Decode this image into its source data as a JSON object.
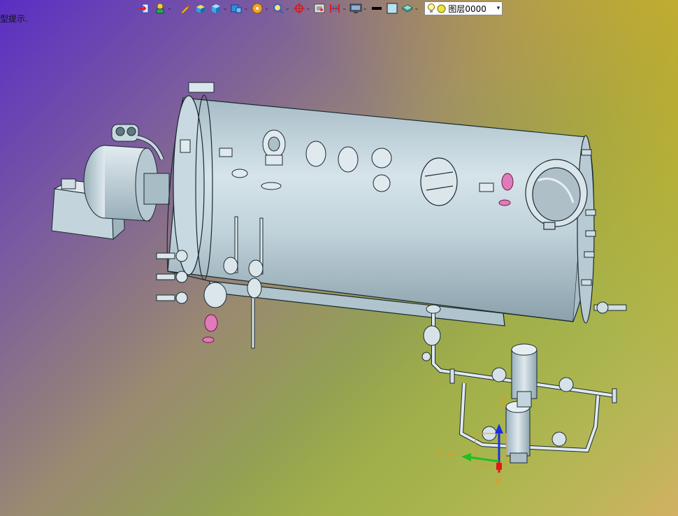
{
  "hint_text": "型提示.",
  "toolbar": {
    "items": [
      {
        "name": "exit-sketch-icon",
        "caret": false
      },
      {
        "name": "part-mode-icon",
        "caret": true
      },
      {
        "name": "pencil-icon",
        "caret": false
      },
      {
        "name": "box-solid-icon",
        "caret": false
      },
      {
        "name": "view-cube-icon",
        "caret": true
      },
      {
        "name": "view-orient-icon",
        "caret": true
      },
      {
        "name": "render-style-icon",
        "caret": true
      },
      {
        "name": "zoom-icon",
        "caret": true
      },
      {
        "name": "pan-rotate-icon",
        "caret": true
      },
      {
        "name": "display-filter-icon",
        "caret": false
      },
      {
        "name": "section-view-icon",
        "caret": true
      },
      {
        "name": "monitor-icon",
        "caret": true
      },
      {
        "name": "line-width-icon",
        "caret": false
      },
      {
        "name": "color-swatch-icon",
        "caret": false
      },
      {
        "name": "layer-tools-icon",
        "caret": true
      }
    ],
    "caret_char": "⌄"
  },
  "layer_dropdown": {
    "label": "图层0000",
    "arrow": "▾"
  },
  "triad": {
    "x_label": "X",
    "y_label": "Y",
    "z_label": "Z"
  },
  "colors": {
    "vessel": "#c8d8e2",
    "vessel_shadow": "#8fa6b2",
    "valve_pink": "#e07ab8",
    "axis_x": "#e01818",
    "axis_y": "#20c020",
    "axis_z": "#1830e0"
  }
}
